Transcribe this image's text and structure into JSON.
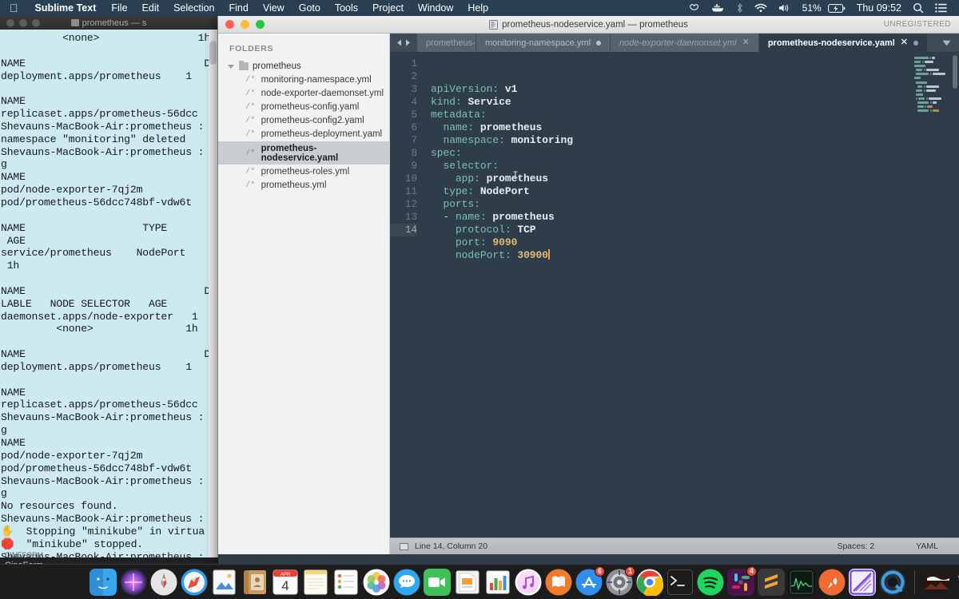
{
  "menubar": {
    "apple_icon": "apple-logo-icon",
    "app_name": "Sublime Text",
    "menus": [
      "File",
      "Edit",
      "Selection",
      "Find",
      "View",
      "Goto",
      "Tools",
      "Project",
      "Window",
      "Help"
    ],
    "status_icons": [
      "creative-cloud-icon",
      "docker-whale-icon",
      "bluetooth-icon",
      "wifi-icon",
      "volume-icon"
    ],
    "battery_percent": "51%",
    "battery_icon": "battery-charging-icon",
    "clock": "Thu 09:52",
    "search_icon": "spotlight-search-icon",
    "control_center_icon": "notification-center-icon"
  },
  "terminal": {
    "window_title": "prometheus — s",
    "lines": [
      "          <none>                1h",
      "",
      "NAME                             DES",
      "deployment.apps/prometheus    1",
      "",
      "NAME",
      "replicaset.apps/prometheus-56dcc",
      "Shevauns-MacBook-Air:prometheus :",
      "namespace \"monitoring\" deleted",
      "Shevauns-MacBook-Air:prometheus :",
      "g",
      "NAME",
      "pod/node-exporter-7qj2m",
      "pod/prometheus-56dcc748bf-vdw6t",
      "",
      "NAME                   TYPE        (",
      " AGE",
      "service/prometheus    NodePort    ",
      " 1h",
      "",
      "NAME                             DI",
      "LABLE   NODE SELECTOR   AGE",
      "daemonset.apps/node-exporter   1",
      "         <none>               1h",
      "",
      "NAME                             DES",
      "deployment.apps/prometheus    1",
      "",
      "NAME",
      "replicaset.apps/prometheus-56dcc",
      "Shevauns-MacBook-Air:prometheus :",
      "g",
      "NAME",
      "pod/node-exporter-7qj2m",
      "pod/prometheus-56dcc748bf-vdw6t",
      "Shevauns-MacBook-Air:prometheus :",
      "g",
      "No resources found.",
      "Shevauns-MacBook-Air:prometheus :",
      "  Stopping \"minikube\" in virtua",
      "  \"minikube\" stopped.",
      "Shevauns-MacBook-Air:prometheus :"
    ],
    "emoji_stop_hand": "✋",
    "emoji_stop_sign": "🛑"
  },
  "background_app": {
    "label": "CineForm",
    "faint_label": "CINEFORM"
  },
  "sublime": {
    "title": "prometheus-nodeservice.yaml — prometheus",
    "title_icon": "document-icon",
    "registration_status": "UNREGISTERED",
    "sidebar": {
      "header": "FOLDERS",
      "folder": "prometheus",
      "files": [
        {
          "ext": "/*",
          "name": "monitoring-namespace.yml",
          "active": false
        },
        {
          "ext": "/*",
          "name": "node-exporter-daemonset.yml",
          "active": false
        },
        {
          "ext": "/*",
          "name": "prometheus-config.yaml",
          "active": false
        },
        {
          "ext": "/*",
          "name": "prometheus-config2.yaml",
          "active": false
        },
        {
          "ext": "/*",
          "name": "prometheus-deployment.yaml",
          "active": false
        },
        {
          "ext": "/*",
          "name": "prometheus-nodeservice.yaml",
          "active": true
        },
        {
          "ext": "/*",
          "name": "prometheus-roles.yml",
          "active": false
        },
        {
          "ext": "/*",
          "name": "prometheus.yml",
          "active": false
        }
      ]
    },
    "tabs": [
      {
        "label": "prometheus-r",
        "state": "clipped",
        "close": "none"
      },
      {
        "label": "monitoring-namespace.yml",
        "state": "unsaved",
        "close": "dot"
      },
      {
        "label": "node-exporter-daemonset.yml",
        "state": "preview",
        "close": "x"
      },
      {
        "label": "prometheus-nodeservice.yaml",
        "state": "active",
        "close": "x-and-dot"
      }
    ],
    "tab_nav_prev_icon": "chevron-left-icon",
    "tab_nav_next_icon": "chevron-right-icon",
    "tab_menu_icon": "chevron-down-icon",
    "editor": {
      "line_numbers": [
        1,
        2,
        3,
        4,
        5,
        6,
        7,
        8,
        9,
        10,
        11,
        12,
        13,
        14
      ],
      "current_line": 14,
      "code_lines": [
        [
          {
            "t": "apiVersion:",
            "c": "k"
          },
          {
            "t": " ",
            "c": "p"
          },
          {
            "t": "v1",
            "c": "v"
          }
        ],
        [
          {
            "t": "kind:",
            "c": "k"
          },
          {
            "t": " ",
            "c": "p"
          },
          {
            "t": "Service",
            "c": "v"
          }
        ],
        [
          {
            "t": "metadata:",
            "c": "k"
          }
        ],
        [
          {
            "t": "  name:",
            "c": "k"
          },
          {
            "t": " ",
            "c": "p"
          },
          {
            "t": "prometheus",
            "c": "v"
          }
        ],
        [
          {
            "t": "  namespace:",
            "c": "k"
          },
          {
            "t": " ",
            "c": "p"
          },
          {
            "t": "monitoring",
            "c": "v"
          }
        ],
        [
          {
            "t": "spec:",
            "c": "k"
          }
        ],
        [
          {
            "t": "  selector:",
            "c": "k"
          }
        ],
        [
          {
            "t": "    app:",
            "c": "k"
          },
          {
            "t": " ",
            "c": "p"
          },
          {
            "t": "prometheus",
            "c": "v"
          }
        ],
        [
          {
            "t": "  type:",
            "c": "k"
          },
          {
            "t": " ",
            "c": "p"
          },
          {
            "t": "NodePort",
            "c": "v"
          }
        ],
        [
          {
            "t": "  ports:",
            "c": "k"
          }
        ],
        [
          {
            "t": "  - ",
            "c": "p"
          },
          {
            "t": "name:",
            "c": "k"
          },
          {
            "t": " ",
            "c": "p"
          },
          {
            "t": "prometheus",
            "c": "v"
          }
        ],
        [
          {
            "t": "    protocol:",
            "c": "k"
          },
          {
            "t": " ",
            "c": "p"
          },
          {
            "t": "TCP",
            "c": "v"
          }
        ],
        [
          {
            "t": "    port:",
            "c": "k"
          },
          {
            "t": " ",
            "c": "p"
          },
          {
            "t": "9090",
            "c": "n"
          }
        ],
        [
          {
            "t": "    nodePort:",
            "c": "k"
          },
          {
            "t": " ",
            "c": "p"
          },
          {
            "t": "30900",
            "c": "n"
          }
        ]
      ],
      "mouse_cursor_icon": "text-ibeam-cursor"
    },
    "statusbar": {
      "icon": "sidebar-toggle-icon",
      "position": "Line 14, Column 20",
      "indentation": "Spaces: 2",
      "syntax": "YAML"
    }
  },
  "dock": {
    "items": [
      {
        "name": "finder",
        "running": true,
        "badge": null
      },
      {
        "name": "siri",
        "running": false,
        "badge": null
      },
      {
        "name": "launchpad",
        "running": false,
        "badge": null
      },
      {
        "name": "safari",
        "running": true,
        "badge": null
      },
      {
        "name": "preview",
        "running": false,
        "badge": null
      },
      {
        "name": "contacts",
        "running": false,
        "badge": null
      },
      {
        "name": "calendar",
        "running": false,
        "badge": null,
        "day": "4",
        "month": "APR"
      },
      {
        "name": "notes",
        "running": false,
        "badge": null
      },
      {
        "name": "reminders",
        "running": false,
        "badge": null
      },
      {
        "name": "photos",
        "running": false,
        "badge": null
      },
      {
        "name": "messages",
        "running": false,
        "badge": null
      },
      {
        "name": "facetime",
        "running": false,
        "badge": null
      },
      {
        "name": "keynote",
        "running": false,
        "badge": null
      },
      {
        "name": "numbers",
        "running": false,
        "badge": null
      },
      {
        "name": "itunes",
        "running": false,
        "badge": null
      },
      {
        "name": "ibooks",
        "running": false,
        "badge": null
      },
      {
        "name": "app-store",
        "running": false,
        "badge": "6"
      },
      {
        "name": "system-preferences",
        "running": true,
        "badge": "1"
      },
      {
        "name": "google-chrome",
        "running": true,
        "badge": null
      },
      {
        "name": "terminal",
        "running": true,
        "badge": null
      },
      {
        "name": "spotify",
        "running": false,
        "badge": null
      },
      {
        "name": "slack",
        "running": false,
        "badge": "4"
      },
      {
        "name": "sublime-text",
        "running": true,
        "badge": null
      },
      {
        "name": "activity-monitor",
        "running": true,
        "badge": null
      },
      {
        "name": "postman",
        "running": true,
        "badge": null
      },
      {
        "name": "photoshop",
        "running": true,
        "badge": null
      },
      {
        "name": "quicktime",
        "running": true,
        "badge": null
      }
    ],
    "trailing": [
      {
        "name": "downloads-stack"
      },
      {
        "name": "trash"
      }
    ]
  }
}
